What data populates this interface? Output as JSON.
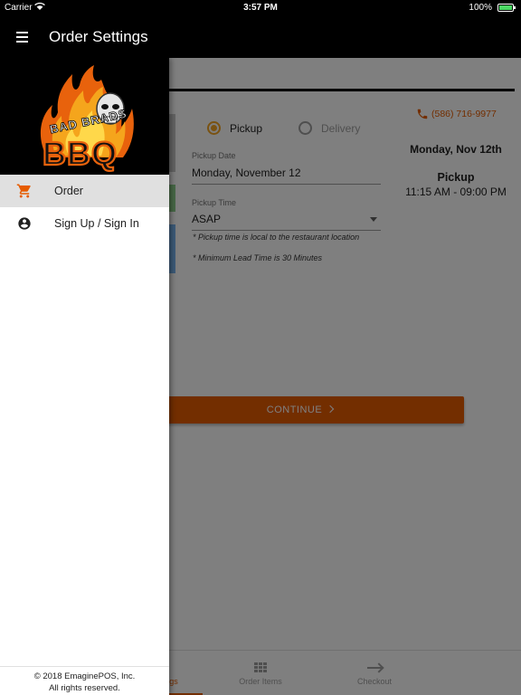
{
  "status_bar": {
    "carrier": "Carrier",
    "time": "3:57 PM",
    "battery": "100%"
  },
  "app_bar": {
    "title": "Order Settings",
    "menu_icon": "hamburger-menu-icon"
  },
  "order_settings": {
    "phone": "(586) 716-9977",
    "order_type_options": [
      {
        "label": "Pickup",
        "selected": true
      },
      {
        "label": "Delivery",
        "selected": false
      }
    ],
    "pickup_date_label": "Pickup Date",
    "pickup_date_value": "Monday, November 12",
    "pickup_time_label": "Pickup Time",
    "pickup_time_value": "ASAP",
    "note_local_time": "* Pickup time is local to the restaurant location",
    "note_lead_time": "* Minimum Lead Time is 30 Minutes",
    "summary_date": "Monday, Nov 12th",
    "summary_type": "Pickup",
    "summary_hours": "11:15 AM - 09:00 PM",
    "continue_label": "CONTINUE"
  },
  "bottom_nav": {
    "settings_partial": "gs",
    "order_items": "Order Items",
    "checkout": "Checkout"
  },
  "drawer": {
    "logo_text_top": "BAD BRADS",
    "logo_text_bottom": "BBQ",
    "items": [
      {
        "label": "Order",
        "icon": "shopping-cart-icon",
        "active": true
      },
      {
        "label": "Sign Up / Sign In",
        "icon": "account-circle-icon",
        "active": false
      }
    ],
    "footer_line1": "© 2018  EmaginePOS, Inc.",
    "footer_line2": "All rights reserved."
  },
  "colors": {
    "accent": "#e65c00",
    "radio_selected": "#f4a522",
    "bar": "#000000"
  }
}
